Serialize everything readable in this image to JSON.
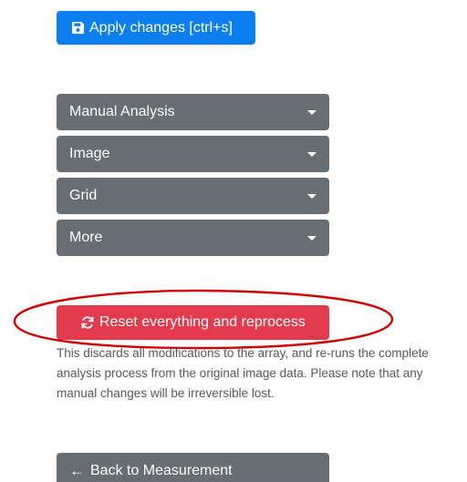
{
  "toolbar": {
    "apply_label": "Apply changes [ctrl+s]",
    "apply_icon": "save-icon",
    "apply_color": "#0d7ef0"
  },
  "dropdowns": [
    {
      "label": "Manual Analysis"
    },
    {
      "label": "Image"
    },
    {
      "label": "Grid"
    },
    {
      "label": "More"
    }
  ],
  "reset": {
    "label": "Reset everything and reprocess",
    "icon": "refresh-icon",
    "color": "#e33a4d",
    "highlight_color": "#d40000",
    "help_text": "This discards all modifications to the array, and re-runs the complete analysis process from the original image data. Please note that any manual changes will be irreversible lost."
  },
  "back": {
    "label": "Back to Measurement",
    "icon": "arrow-left-icon"
  },
  "colors": {
    "dropdown_bg": "#666d73"
  }
}
